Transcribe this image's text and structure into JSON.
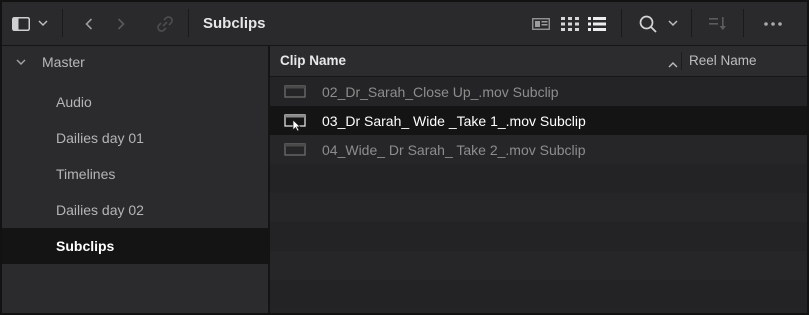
{
  "toolbar": {
    "title": "Subclips",
    "icons": [
      "sidebar-toggle-icon",
      "chevron-down-icon",
      "back-arrow-icon",
      "forward-arrow-icon",
      "link-icon",
      "metadata-view-icon",
      "thumbnail-view-icon",
      "list-view-icon",
      "search-icon",
      "chevron-down-icon",
      "sort-icon",
      "more-icon"
    ]
  },
  "sidebar": {
    "root_label": "Master",
    "items": [
      {
        "label": "Audio"
      },
      {
        "label": "Dailies day 01"
      },
      {
        "label": "Timelines"
      },
      {
        "label": "Dailies day 02"
      },
      {
        "label": "Subclips",
        "selected": true
      }
    ]
  },
  "list": {
    "columns": {
      "clip_name": "Clip Name",
      "reel_name": "Reel Name"
    },
    "rows": [
      {
        "name": "02_Dr_Sarah_Close Up_.mov Subclip",
        "selected": false
      },
      {
        "name": "03_Dr Sarah_ Wide _Take 1_.mov Subclip",
        "selected": true
      },
      {
        "name": "04_Wide_ Dr Sarah_ Take 2_.mov Subclip",
        "selected": false
      }
    ]
  },
  "colors": {
    "selected_row": "#141414",
    "panel": "#262628",
    "text_dim": "#8d8d8d"
  }
}
